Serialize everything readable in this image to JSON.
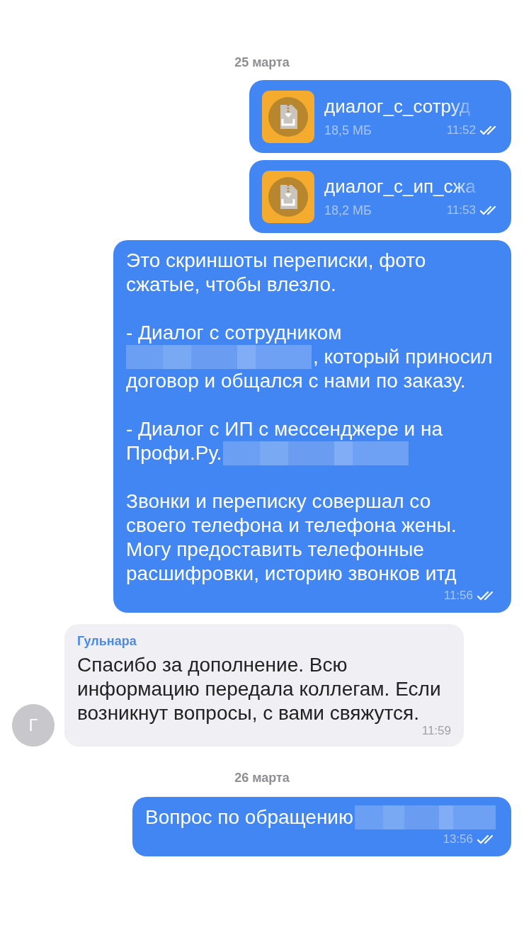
{
  "messages": [
    {
      "kind": "date",
      "text": "25 марта"
    },
    {
      "kind": "file",
      "name": "диалог_с_сотруд",
      "size": "18,5 МБ",
      "time": "11:52",
      "read": true
    },
    {
      "kind": "file",
      "name": "диалог_с_ип_сжа",
      "size": "18,2 МБ",
      "time": "11:53",
      "read": true
    },
    {
      "kind": "outgoing",
      "time": "11:56",
      "read": true,
      "paragraphs": [
        [
          [
            {
              "kind": "text",
              "text": "Это скриншоты переписки, фото сжатые, чтобы влезло."
            }
          ]
        ],
        [
          [
            {
              "kind": "text",
              "text": "- Диалог с сотрудником"
            }
          ],
          [
            {
              "kind": "redacted"
            },
            {
              "kind": "text",
              "text": ", который приносил"
            }
          ],
          [
            {
              "kind": "text",
              "text": "договор и общался с нами по заказу."
            }
          ]
        ],
        [
          [
            {
              "kind": "text",
              "text": "- Диалог с ИП с мессенджере и на"
            }
          ],
          [
            {
              "kind": "text",
              "text": "Профи.Ру."
            },
            {
              "kind": "redacted"
            }
          ]
        ],
        [
          [
            {
              "kind": "text",
              "text": "Звонки и переписку совершал со своего телефона и телефона жены. Могу предоставить телефонные расшифровки, историю звонков итд"
            }
          ]
        ]
      ]
    },
    {
      "kind": "incoming",
      "sender": "Гульнара",
      "avatar": "Г",
      "time": "11:59",
      "paragraphs": [
        [
          [
            {
              "kind": "text",
              "text": "Спасибо за дополнение. Всю информацию передала коллегам. Если возникнут вопросы, с вами свяжутся."
            }
          ]
        ]
      ]
    },
    {
      "kind": "date",
      "text": "26 марта"
    },
    {
      "kind": "outgoing",
      "time": "13:56",
      "read": true,
      "paragraphs": [
        [
          [
            {
              "kind": "text",
              "text": "Вопрос по обращению"
            },
            {
              "kind": "redacted"
            }
          ]
        ]
      ]
    }
  ]
}
